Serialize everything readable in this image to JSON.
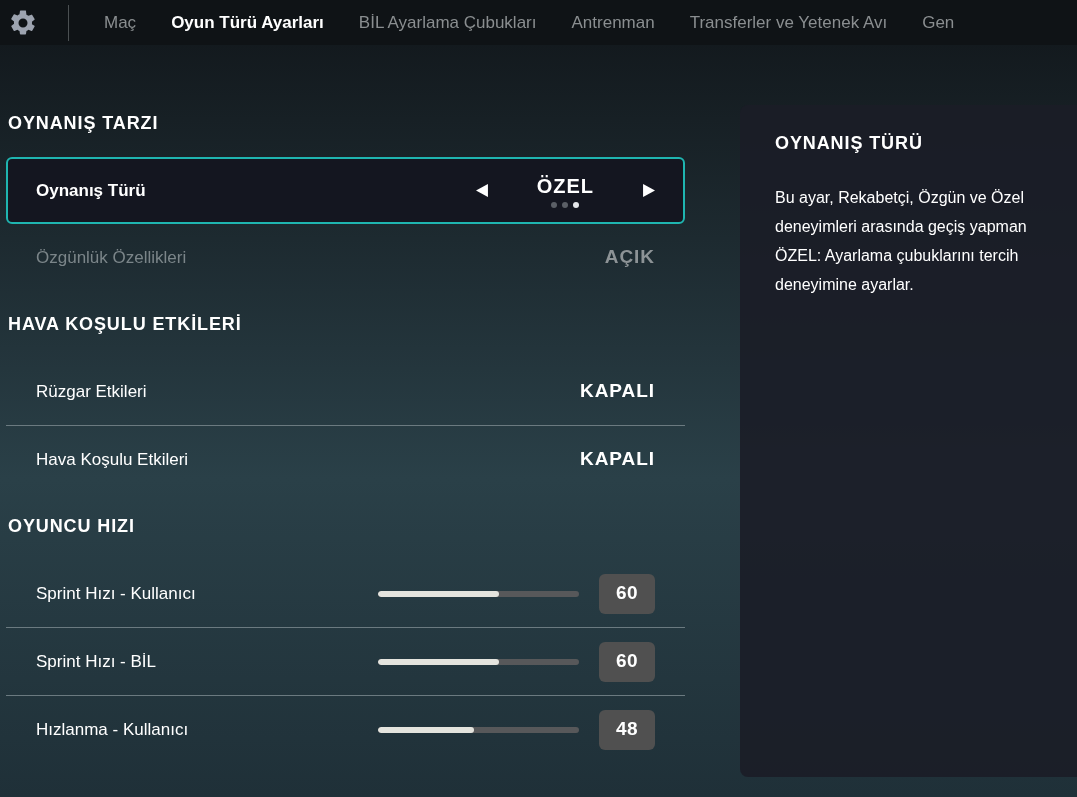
{
  "nav": {
    "tabs": [
      {
        "label": "Maç",
        "selected": false
      },
      {
        "label": "Oyun Türü Ayarları",
        "selected": true
      },
      {
        "label": "BİL Ayarlama Çubukları",
        "selected": false
      },
      {
        "label": "Antrenman",
        "selected": false
      },
      {
        "label": "Transferler ve Yetenek Avı",
        "selected": false
      },
      {
        "label": "Gen",
        "selected": false
      }
    ]
  },
  "sections": [
    {
      "title": "OYNANIŞ TARZI",
      "rows": [
        {
          "kind": "selector",
          "label": "Oynanış Türü",
          "value": "ÖZEL",
          "selected": true,
          "disabled": false,
          "options": [
            {
              "selected": false
            },
            {
              "selected": false
            },
            {
              "selected": true
            }
          ]
        },
        {
          "kind": "toggle",
          "label": "Özgünlük Özellikleri",
          "value": "AÇIK",
          "selected": false,
          "disabled": true
        }
      ]
    },
    {
      "title": "HAVA KOŞULU ETKİLERİ",
      "rows": [
        {
          "kind": "toggle",
          "label": "Rüzgar Etkileri",
          "value": "KAPALI",
          "selected": false,
          "disabled": false
        },
        {
          "kind": "toggle",
          "label": "Hava Koşulu Etkileri",
          "value": "KAPALI",
          "selected": false,
          "disabled": false
        }
      ]
    },
    {
      "title": "OYUNCU HIZI",
      "rows": [
        {
          "kind": "slider",
          "label": "Sprint Hızı - Kullanıcı",
          "value": "60",
          "level": 0.6,
          "selected": false,
          "disabled": false
        },
        {
          "kind": "slider",
          "label": "Sprint Hızı - BİL",
          "value": "60",
          "level": 0.6,
          "selected": false,
          "disabled": false
        },
        {
          "kind": "slider",
          "label": "Hızlanma - Kullanıcı",
          "value": "48",
          "level": 0.48,
          "selected": false,
          "disabled": false
        }
      ]
    }
  ],
  "info_panel": {
    "title": "OYNANIŞ TÜRÜ",
    "lines": [
      "Bu ayar, Rekabetçi, Özgün ve Özel",
      "deneyimleri arasında geçiş yapman",
      "ÖZEL: Ayarlama çubuklarını tercih",
      "deneyimine ayarlar."
    ]
  }
}
